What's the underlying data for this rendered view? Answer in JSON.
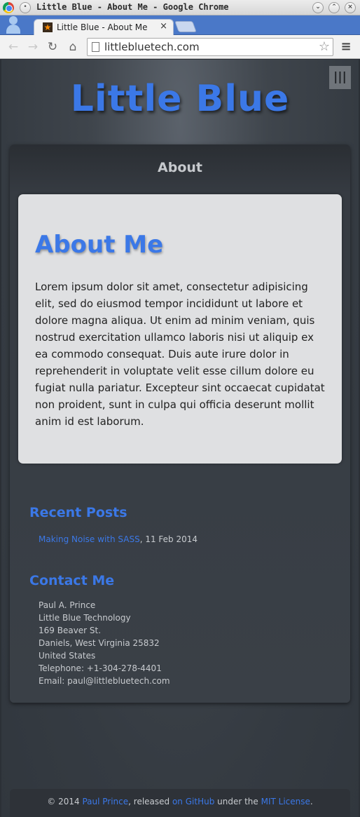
{
  "window": {
    "title": "Little Blue - About Me - Google Chrome",
    "tab_title": "Little Blue - About Me",
    "tab_close": "×"
  },
  "toolbar": {
    "url": "littlebluetech.com"
  },
  "icons": {
    "back": "←",
    "forward": "→",
    "reload": "↻",
    "home": "⌂",
    "star": "☆",
    "menu": "≡",
    "nav_toggle": "|||"
  },
  "site": {
    "title": "Little Blue",
    "section_heading": "About"
  },
  "article": {
    "heading": "About Me",
    "body": "Lorem ipsum dolor sit amet, consectetur adipisicing elit, sed do eiusmod tempor incididunt ut labore et dolore magna aliqua. Ut enim ad minim veniam, quis nostrud exercitation ullamco laboris nisi ut aliquip ex ea commodo consequat. Duis aute irure dolor in reprehenderit in voluptate velit esse cillum dolore eu fugiat nulla pariatur. Excepteur sint occaecat cupidatat non proident, sunt in culpa qui officia deserunt mollit anim id est laborum."
  },
  "recent_posts": {
    "heading": "Recent Posts",
    "items": [
      {
        "title": "Making Noise with SASS",
        "date": ", 11 Feb 2014"
      }
    ]
  },
  "contact": {
    "heading": "Contact Me",
    "lines": [
      "Paul A. Prince",
      "Little Blue Technology",
      "169 Beaver St.",
      "Daniels, West Virginia 25832",
      "United States",
      "Telephone: +1-304-278-4401",
      "Email: paul@littlebluetech.com"
    ]
  },
  "footer": {
    "prefix": "© 2014 ",
    "author": "Paul Prince",
    "middle": ", released ",
    "github": "on GitHub",
    "under": " under the ",
    "license": "MIT License",
    "suffix": "."
  },
  "colors": {
    "accent": "#3b78e7",
    "card_bg": "#dfe0e2",
    "page_bg": "#3a4047"
  }
}
